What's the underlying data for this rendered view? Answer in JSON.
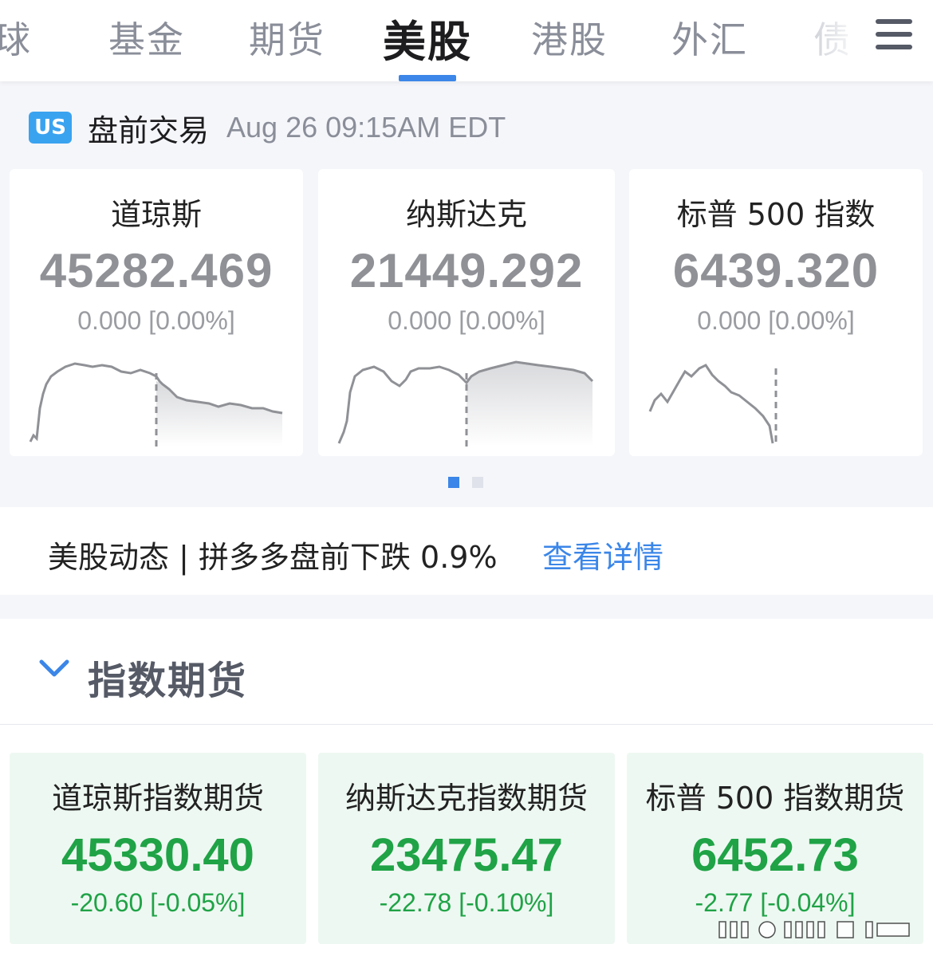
{
  "tabs": [
    {
      "label": "全球",
      "display": "球"
    },
    {
      "label": "基金"
    },
    {
      "label": "期货"
    },
    {
      "label": "美股",
      "active": true
    },
    {
      "label": "港股"
    },
    {
      "label": "外汇"
    },
    {
      "label": "债"
    }
  ],
  "premarket": {
    "badge": "US",
    "title": "盘前交易",
    "time": "Aug 26 09:15AM EDT"
  },
  "indices": [
    {
      "name": "道琼斯",
      "value": "45282.469",
      "change": "0.000 [0.00%]"
    },
    {
      "name": "纳斯达克",
      "value": "21449.292",
      "change": "0.000 [0.00%]"
    },
    {
      "name": "标普 500 指数",
      "value": "6439.320",
      "change": "0.000 [0.00%]"
    }
  ],
  "pager": {
    "total": 2,
    "active": 0
  },
  "news": {
    "text": "美股动态 | 拼多多盘前下跌 0.9%",
    "link": "查看详情"
  },
  "futures": {
    "title": "指数期货",
    "items": [
      {
        "name": "道琼斯指数期货",
        "value": "45330.40",
        "change": "-20.60 [-0.05%]"
      },
      {
        "name": "纳斯达克指数期货",
        "value": "23475.47",
        "change": "-22.78 [-0.10%]"
      },
      {
        "name": "标普 500 指数期货",
        "value": "6452.73",
        "change": "-2.77 [-0.04%]"
      }
    ]
  },
  "colors": {
    "accent": "#3b86e8",
    "up_green": "#1fa346",
    "flat_gray": "#8f9196",
    "us_badge": "#3aa3f0"
  }
}
